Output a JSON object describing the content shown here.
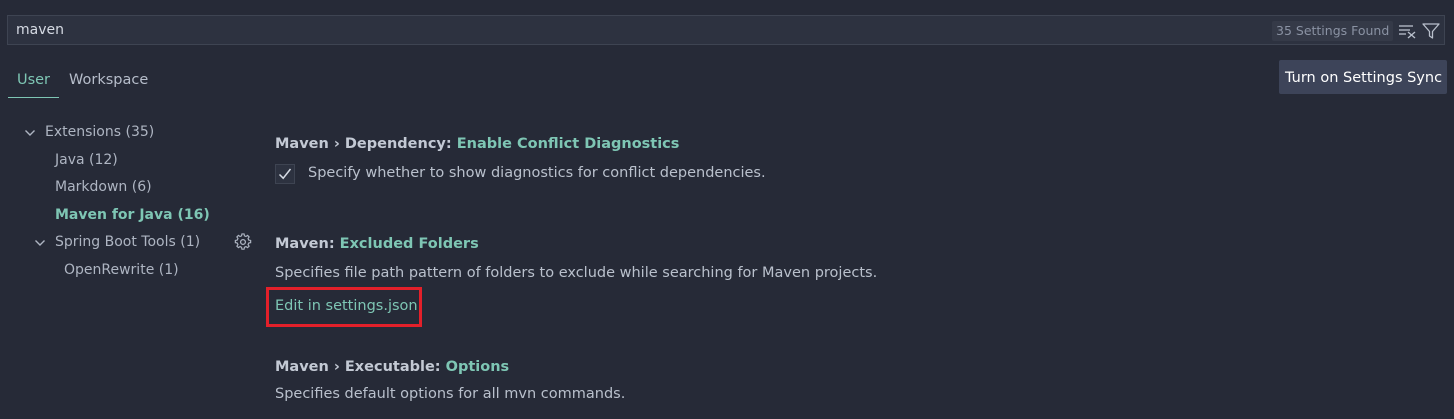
{
  "search": {
    "value": "maven",
    "results_count": "35 Settings Found"
  },
  "tabs": [
    {
      "label": "User",
      "active": true
    },
    {
      "label": "Workspace",
      "active": false
    }
  ],
  "sync_button": "Turn on Settings Sync",
  "toc": [
    {
      "label": "Extensions",
      "count": "(35)",
      "expanded": true
    },
    {
      "label": "Java",
      "count": "(12)"
    },
    {
      "label": "Markdown",
      "count": "(6)"
    },
    {
      "label": "Maven for Java",
      "count": "(16)",
      "active": true
    },
    {
      "label": "Spring Boot Tools",
      "count": "(1)",
      "expanded": true
    },
    {
      "label": "OpenRewrite",
      "count": "(1)"
    }
  ],
  "settings": [
    {
      "category": "Maven › Dependency: ",
      "name": "Enable Conflict Diagnostics",
      "description": "Specify whether to show diagnostics for conflict dependencies.",
      "checked": true
    },
    {
      "category": "Maven: ",
      "name": "Excluded Folders",
      "description": "Specifies file path pattern of folders to exclude while searching for Maven projects.",
      "link": "Edit in settings.json"
    },
    {
      "category": "Maven › Executable: ",
      "name": "Options",
      "description": "Specifies default options for all mvn commands."
    }
  ],
  "colors": {
    "background": "#262a37",
    "accent": "#7ec6b4",
    "highlight_box": "#e3202a",
    "button_bg": "#3d4459"
  }
}
